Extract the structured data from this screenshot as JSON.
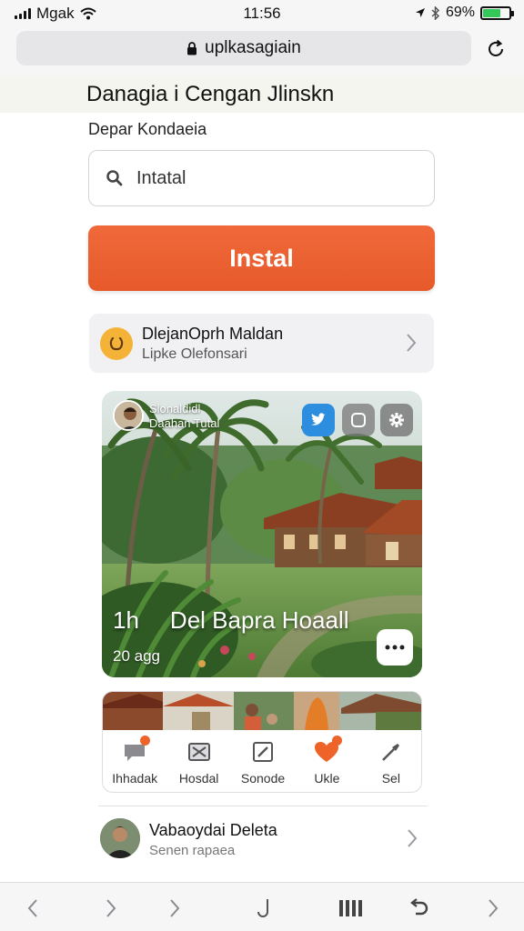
{
  "status": {
    "carrier": "Mgak",
    "time": "11:56",
    "battery": "69%",
    "battery_level": 0.69
  },
  "browser": {
    "url": "uplkasagiain"
  },
  "page": {
    "title": "Danagia i Cengan Jlinskn",
    "section_label": "Depar Kondaeia"
  },
  "search": {
    "value": "Intatal",
    "placeholder": "Intatal"
  },
  "install_button": {
    "label": "Instal",
    "color": "#ea602f"
  },
  "profile_card": {
    "title": "DlejanOprh Maldan",
    "subtitle": "Lipke Olefonsari",
    "avatar_color": "#f4b237"
  },
  "post": {
    "author_line1": "Slonaldidl",
    "author_line2": "Daahan Tutal",
    "caption_prefix": "1h",
    "caption": "Del Bapra Hoaall",
    "count": "20 agg",
    "share_icons": [
      "twitter-icon",
      "instagram-icon",
      "settings-icon"
    ]
  },
  "actions": [
    {
      "label": "Ihhadak",
      "icon": "comment-icon"
    },
    {
      "label": "Hosdal",
      "icon": "bookmark-icon"
    },
    {
      "label": "Sonode",
      "icon": "edit-icon"
    },
    {
      "label": "Ukle",
      "icon": "like-icon"
    },
    {
      "label": "Sel",
      "icon": "share-icon"
    }
  ],
  "person": {
    "name": "Vabaoydai Deleta",
    "subtitle": "Senen rapaea"
  },
  "colors": {
    "accent": "#ea602f",
    "twitter": "#2d8ee0"
  }
}
